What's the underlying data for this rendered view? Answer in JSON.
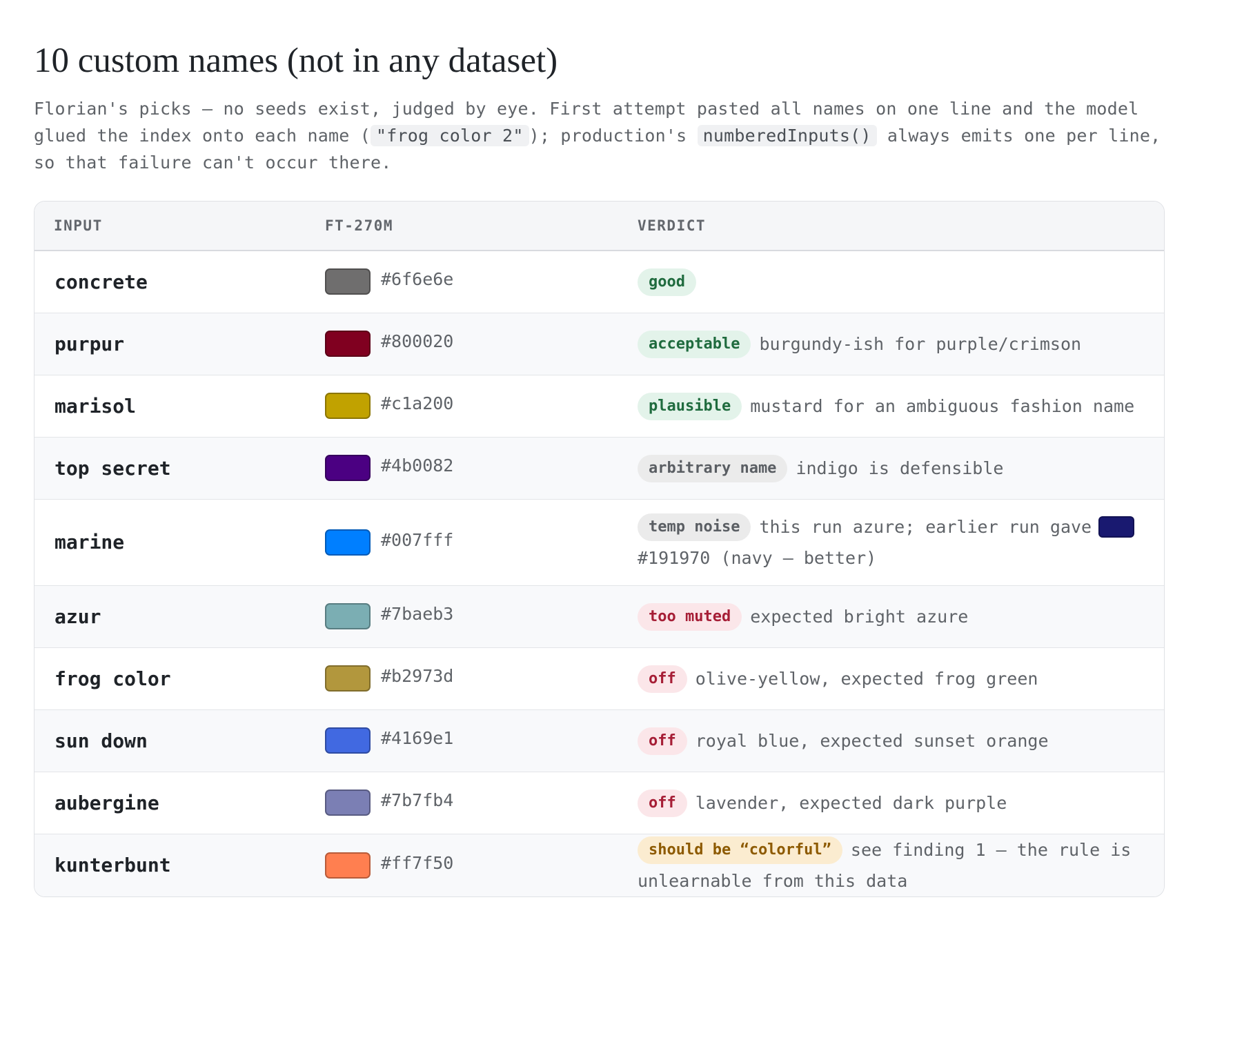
{
  "title": "10 custom names (not in any dataset)",
  "intro": {
    "text_1": "Florian's picks — no seeds exist, judged by eye. First attempt pasted all names on one line and the model glued the index onto each name (",
    "code_1": "\"frog color 2\"",
    "text_2": "); production's ",
    "code_2": "numberedInputs()",
    "text_3": " always emits one per line, so that failure can't occur there."
  },
  "table": {
    "headers": {
      "input": "INPUT",
      "model": "FT-270M",
      "verdict": "VERDICT"
    },
    "rows": [
      {
        "input": "concrete",
        "hex": "#6f6e6e",
        "swatch": "#6f6e6e",
        "badge": "good",
        "badge_style": "good",
        "note": ""
      },
      {
        "input": "purpur",
        "hex": "#800020",
        "swatch": "#800020",
        "badge": "acceptable",
        "badge_style": "good",
        "note": "burgundy-ish for purple/crimson"
      },
      {
        "input": "marisol",
        "hex": "#c1a200",
        "swatch": "#c1a200",
        "badge": "plausible",
        "badge_style": "good",
        "note": "mustard for an ambiguous fashion name"
      },
      {
        "input": "top secret",
        "hex": "#4b0082",
        "swatch": "#4b0082",
        "badge": "arbitrary name",
        "badge_style": "grey",
        "note": "indigo is defensible"
      },
      {
        "input": "marine",
        "hex": "#007fff",
        "swatch": "#007fff",
        "badge": "temp noise",
        "badge_style": "grey",
        "note": "this run azure; earlier run gave",
        "note_swatch": "#191970",
        "note_tail": "#191970 (navy — better)"
      },
      {
        "input": "azur",
        "hex": "#7baeb3",
        "swatch": "#7baeb3",
        "badge": "too muted",
        "badge_style": "red",
        "note": "expected bright azure"
      },
      {
        "input": "frog color",
        "hex": "#b2973d",
        "swatch": "#b2973d",
        "badge": "off",
        "badge_style": "red",
        "note": "olive-yellow, expected frog green"
      },
      {
        "input": "sun down",
        "hex": "#4169e1",
        "swatch": "#4169e1",
        "badge": "off",
        "badge_style": "red",
        "note": "royal blue, expected sunset orange"
      },
      {
        "input": "aubergine",
        "hex": "#7b7fb4",
        "swatch": "#7b7fb4",
        "badge": "off",
        "badge_style": "red",
        "note": "lavender, expected dark purple"
      },
      {
        "input": "kunterbunt",
        "hex": "#ff7f50",
        "swatch": "#ff7f50",
        "badge": "should be “colorful”",
        "badge_style": "yellow",
        "note": "see finding 1 — the rule is unlearnable from this data"
      }
    ]
  }
}
